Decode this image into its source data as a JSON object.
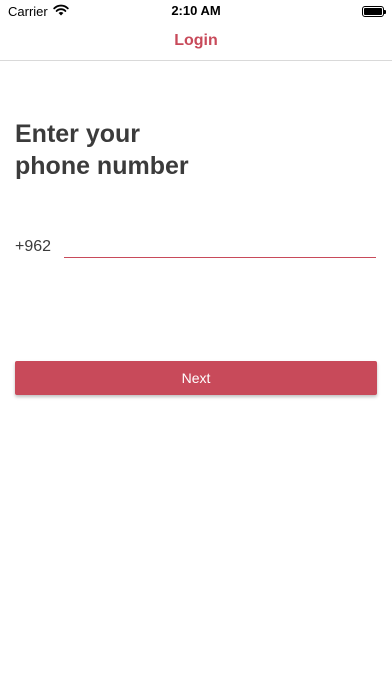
{
  "status_bar": {
    "carrier": "Carrier",
    "time": "2:10 AM",
    "icons": [
      "wifi-icon",
      "battery-icon"
    ]
  },
  "nav": {
    "title": "Login"
  },
  "heading": {
    "line1": "Enter your",
    "line2": "phone number"
  },
  "phone": {
    "country_code": "+962",
    "value": "",
    "placeholder": ""
  },
  "actions": {
    "next_label": "Next"
  },
  "colors": {
    "accent": "#c84a5a",
    "heading_text": "#3b3b3b",
    "divider": "#d9d9d9"
  }
}
